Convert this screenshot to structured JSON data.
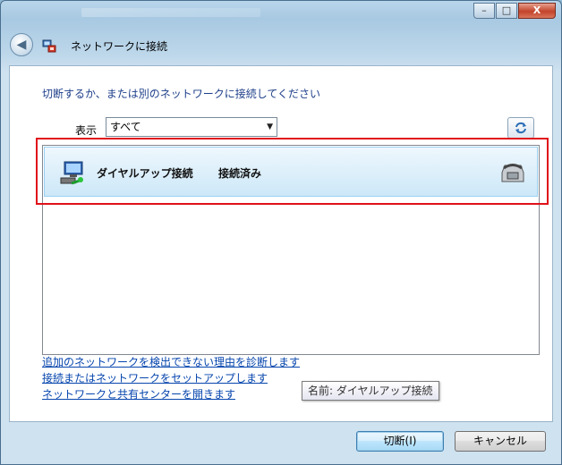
{
  "window": {
    "nav_title": "ネットワークに接続",
    "controls": {
      "minimize": "–",
      "maximize": "□",
      "close": "X"
    }
  },
  "main": {
    "prompt": "切断するか、または別のネットワークに接続してください",
    "show_label": "表示",
    "show_select_value": "すべて",
    "connections": [
      {
        "name": "ダイヤルアップ接続",
        "status": "接続済み",
        "icon": "network-connection-icon",
        "type_icon": "telephone-icon"
      }
    ],
    "tooltip": "名前: ダイヤルアップ接続"
  },
  "links": [
    "追加のネットワークを検出できない理由を診断します",
    "接続またはネットワークをセットアップします",
    "ネットワークと共有センターを開きます"
  ],
  "buttons": {
    "disconnect": "切断(I)",
    "cancel": "キャンセル"
  },
  "colors": {
    "highlight_red": "#e0101a",
    "link": "#0645ad",
    "prompt_text": "#1e3f8a",
    "selection_bg": "#cde8f8"
  }
}
